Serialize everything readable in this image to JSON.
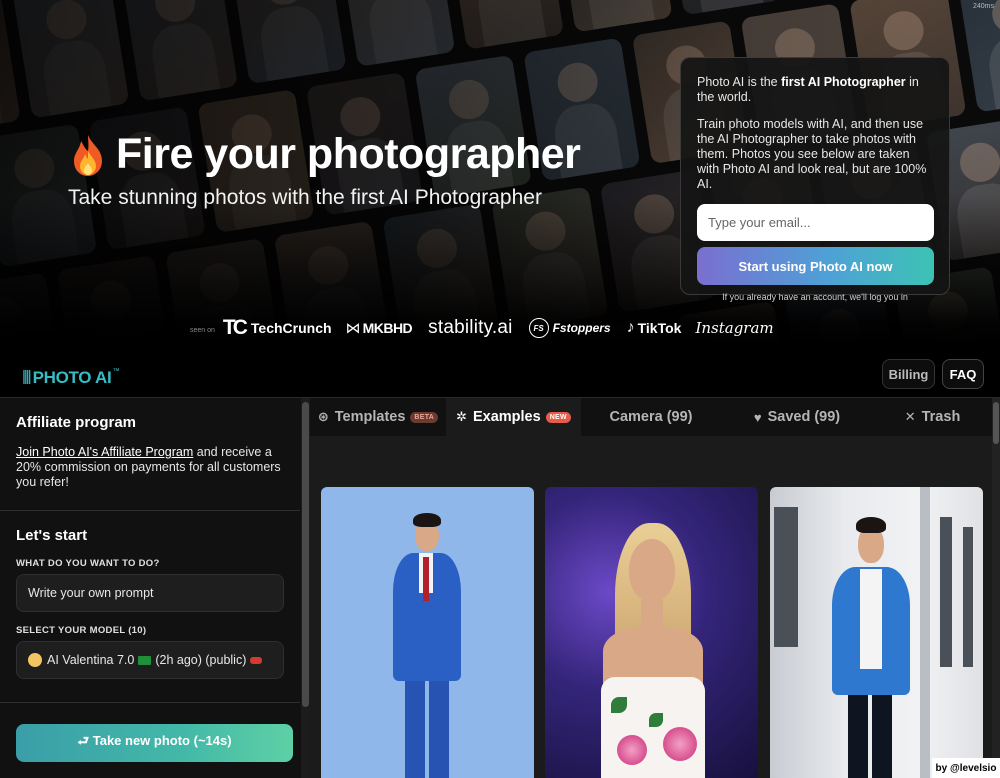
{
  "hero": {
    "corner_note": "240ms",
    "title": "Fire your photographer",
    "subtitle": "Take stunning photos with the first AI Photographer",
    "card": {
      "line1_pre": "Photo AI is the ",
      "line1_bold": "first AI Photographer",
      "line1_post": " in the world.",
      "paragraph2": "Train photo models with AI, and then use the AI Photographer to take photos with them. Photos you see below are taken with Photo AI and look real, but are 100% AI.",
      "email_placeholder": "Type your email...",
      "cta_label": "Start using Photo AI now",
      "login_note": "If you already have an account, we'll log you in"
    }
  },
  "press": {
    "seen_on": "seen on",
    "brands": {
      "techcrunch": "TechCrunch",
      "mkbhd": "MKBHD",
      "stability": "stability.ai",
      "fstoppers_mark": "FS",
      "fstoppers": "Fstoppers",
      "tiktok": "TikTok",
      "instagram": "Instagram"
    }
  },
  "appbar": {
    "logo_text": "PHOTO AI",
    "logo_tm": "™",
    "billing_label": "Billing",
    "faq_label": "FAQ"
  },
  "sidebar": {
    "affiliate_title": "Affiliate program",
    "affiliate_link": "Join Photo AI's Affiliate Program",
    "affiliate_text": " and receive a 20% commission on payments for all customers you refer!",
    "start_title": "Let's start",
    "what_label": "WHAT DO YOU WANT TO DO?",
    "what_value": "Write your own prompt",
    "model_label": "SELECT YOUR MODEL (10)",
    "model_value_pre": "AI Valentina 7.0",
    "model_value_post": "(2h ago) (public)",
    "take_photo_label": "⮐ Take new photo (~14s)"
  },
  "tabs": [
    {
      "label": "Templates",
      "badge": "BETA",
      "icon": "openai-icon"
    },
    {
      "label": "Examples",
      "badge": "NEW",
      "icon": "sparkle-icon"
    },
    {
      "label": "Camera (99)"
    },
    {
      "label": "Saved (99)",
      "icon": "heart-icon"
    },
    {
      "label": "Trash",
      "icon": "x-icon"
    }
  ],
  "byline": "by @levelsio",
  "colors": {
    "accent_teal": "#36bcc4",
    "cta_gradient_start": "#7a6fd0",
    "cta_gradient_end": "#3cc3b4",
    "badge_new": "#e85b48"
  }
}
